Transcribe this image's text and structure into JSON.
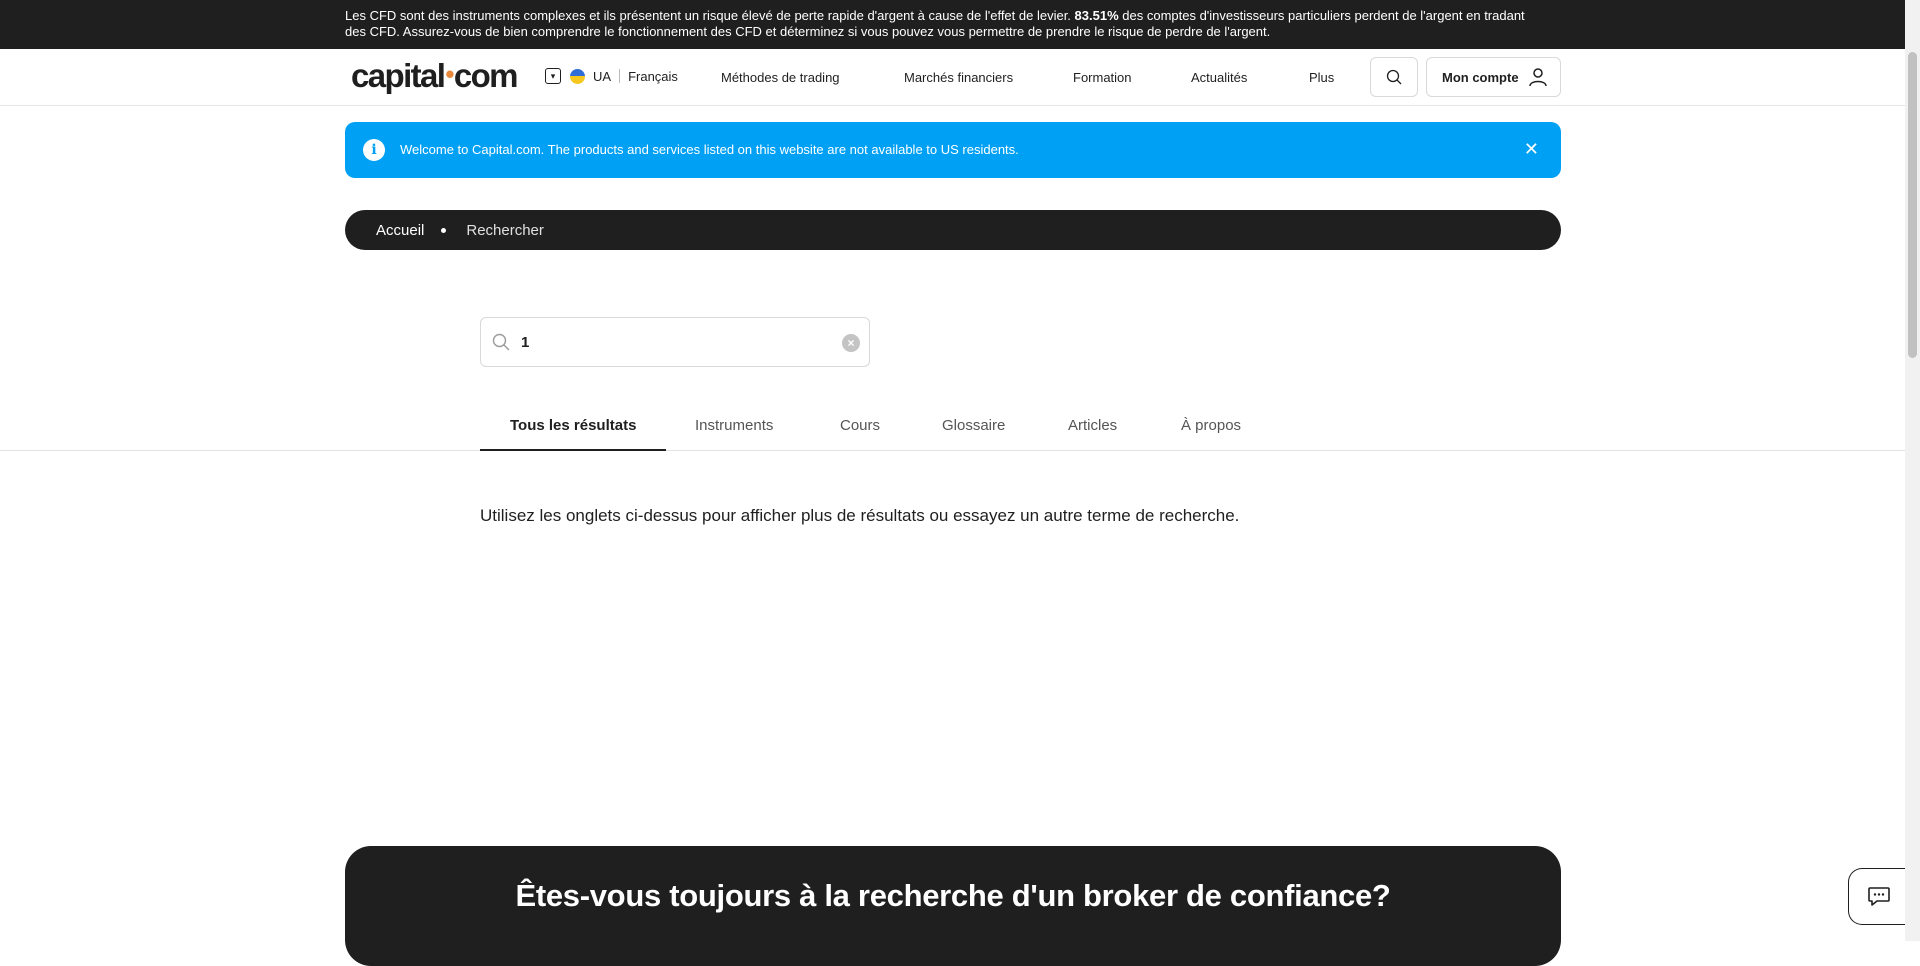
{
  "risk_warning": {
    "text_before": "Les CFD sont des instruments complexes et ils présentent un risque élevé de perte rapide d'argent à cause de l'effet de levier.",
    "percentage": "83.51%",
    "text_after": "des comptes d'investisseurs particuliers perdent de l'argent en tradant des CFD. Assurez-vous de bien comprendre le fonctionnement des CFD et déterminez si vous pouvez vous permettre de prendre le risque de perdre de l'argent."
  },
  "header": {
    "logo_left": "capital",
    "logo_dot": "•",
    "logo_right": "com",
    "region": "UA",
    "language": "Français",
    "nav": [
      "Méthodes de trading",
      "Marchés financiers",
      "Formation",
      "Actualités",
      "Plus"
    ],
    "account_label": "Mon compte"
  },
  "notice": {
    "icon": "i",
    "message": "Welcome to Capital.com. The products and services listed on this website are not available to US residents.",
    "close": "✕"
  },
  "breadcrumb": {
    "home": "Accueil",
    "current": "Rechercher"
  },
  "search": {
    "value": "1",
    "clear": "×"
  },
  "tabs": [
    "Tous les résultats",
    "Instruments",
    "Cours",
    "Glossaire",
    "Articles",
    "À propos"
  ],
  "active_tab": "Tous les résultats",
  "hint": "Utilisez les onglets ci-dessus pour afficher plus de résultats ou essayez un autre terme de recherche.",
  "cta": {
    "title": "Êtes-vous toujours à la recherche d'un broker de confiance?"
  },
  "colors": {
    "dark": "#1f1f1f",
    "notice_blue": "#00a0f5",
    "logo_dot": "#e8883a"
  }
}
